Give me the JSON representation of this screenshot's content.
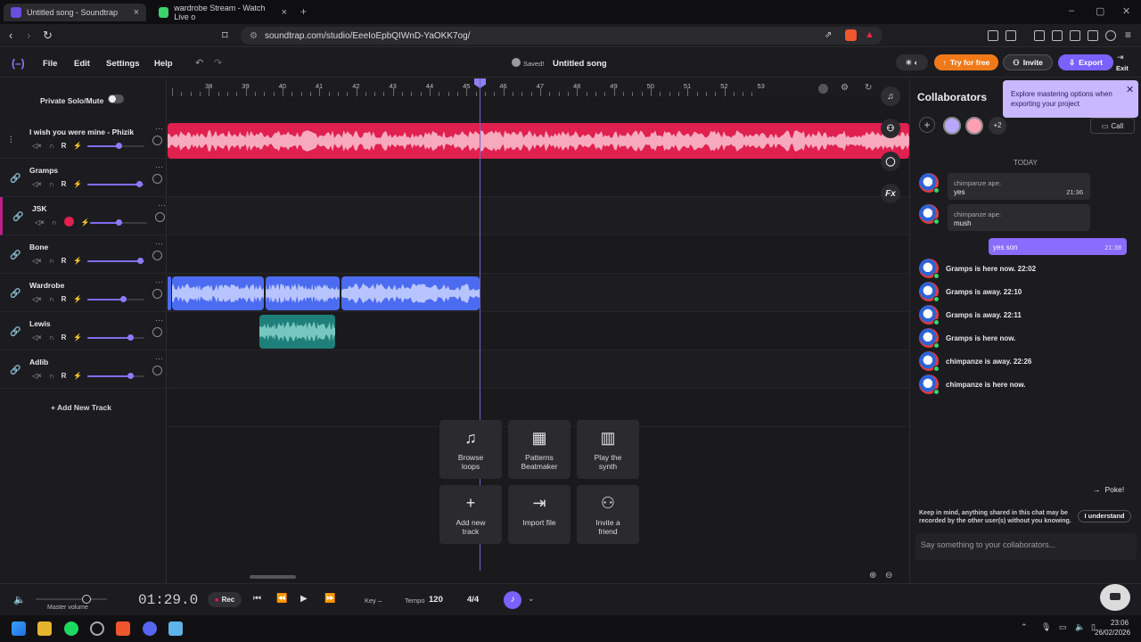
{
  "browser": {
    "tabs": [
      {
        "title": "Untitled song - Soundtrap",
        "active": true
      },
      {
        "title": "wardrobe Stream - Watch Live o",
        "active": false
      }
    ],
    "url": "soundtrap.com/studio/EeeIoEpbQIWnD-YaOKK7og/"
  },
  "app": {
    "menu": [
      "File",
      "Edit",
      "Settings",
      "Help"
    ],
    "saved_label": "Saved!",
    "song_title": "Untitled song",
    "try_free": "Try for free",
    "invite": "Invite",
    "export": "Export",
    "exit": "Exit",
    "private_solo_mute": "Private Solo/Mute",
    "add_new_track": "Add New Track"
  },
  "tracks": [
    {
      "name": "I wish you were mine - Phizik",
      "volume": 0.55
    },
    {
      "name": "Gramps",
      "volume": 0.9
    },
    {
      "name": "JSK",
      "volume": 0.5
    },
    {
      "name": "Bone",
      "volume": 0.92
    },
    {
      "name": "Wardrobe",
      "volume": 0.62
    },
    {
      "name": "Lewis",
      "volume": 0.75
    },
    {
      "name": "Adlib",
      "volume": 0.75
    }
  ],
  "track_controls": {
    "record": "R"
  },
  "ruler": {
    "labels": [
      "38",
      "39",
      "40",
      "41",
      "42",
      "43",
      "44",
      "45",
      "46",
      "47",
      "48",
      "49",
      "50",
      "51",
      "52",
      "53"
    ]
  },
  "tiles": [
    {
      "label_1": "Browse",
      "label_2": "loops",
      "icon": "music-note-icon"
    },
    {
      "label_1": "Patterns",
      "label_2": "Beatmaker",
      "icon": "grid-icon"
    },
    {
      "label_1": "Play the",
      "label_2": "synth",
      "icon": "piano-icon"
    },
    {
      "label_1": "Add new",
      "label_2": "track",
      "icon": "plus-icon"
    },
    {
      "label_1": "Import file",
      "label_2": "",
      "icon": "import-icon"
    },
    {
      "label_1": "Invite a",
      "label_2": "friend",
      "icon": "add-user-icon"
    }
  ],
  "fx_label": "Fx",
  "collab": {
    "title": "Collaborators",
    "tooltip": "Explore mastering options when exporting your project",
    "more_count": "+2",
    "call": "Call",
    "today": "TODAY",
    "messages": [
      {
        "who": "chimpanze ape:",
        "text": "yes",
        "time": "21:36"
      },
      {
        "who": "chimpanze ape:",
        "text": "mush",
        "time": ""
      }
    ],
    "own_message": {
      "text": "yes son",
      "time": "21:38"
    },
    "system": [
      "Gramps is here now. 22:02",
      "Gramps is away. 22:10",
      "Gramps is away. 22:11",
      "Gramps is here now.",
      "chimpanze is away. 22:26",
      "chimpanze is here now."
    ],
    "poke": "Poke!",
    "notice": "Keep in mind, anything shared in this chat may be recorded by the other user(s) without you knowing.",
    "understand": "I understand",
    "input_placeholder": "Say something to your collaborators..."
  },
  "transport": {
    "master_volume": "Master volume",
    "time": "01:29.0",
    "rec": "Rec",
    "key_label": "Key",
    "key_value": "–",
    "tempo_label": "Tempo",
    "tempo_value": "120",
    "signature": "4/4"
  },
  "taskbar": {
    "time": "23:06",
    "date": "26/02/2026"
  },
  "colors": {
    "accent": "#7b61ff",
    "track_red": "#e0204f",
    "region_blue": "#4b6bf0",
    "region_teal": "#1f7f7a",
    "try_free": "#f07a1a"
  }
}
